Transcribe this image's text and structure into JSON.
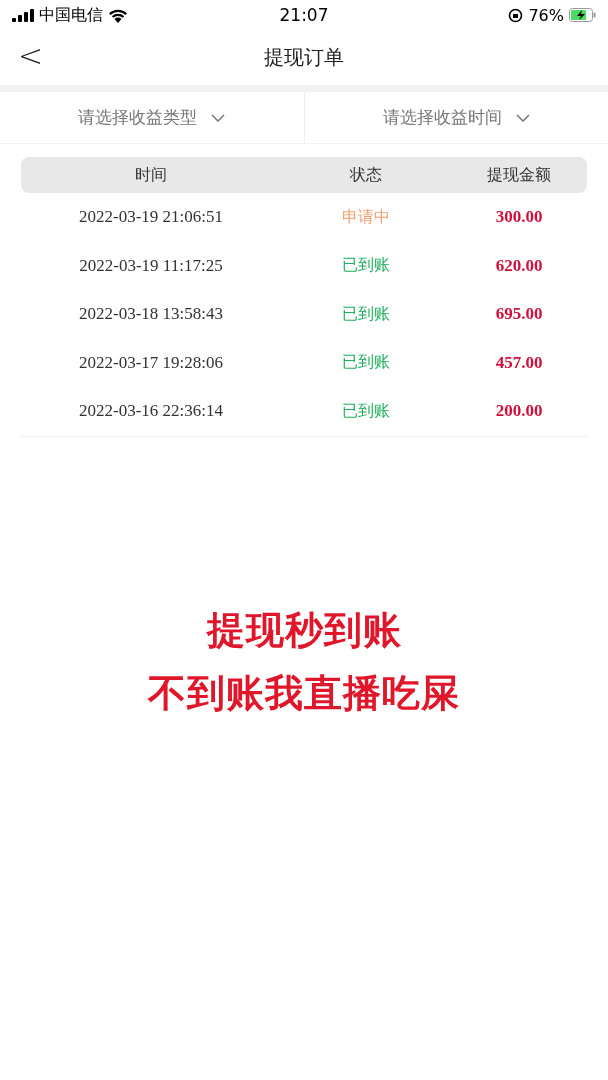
{
  "status_bar": {
    "carrier": "中国电信",
    "time": "21:07",
    "battery": "76%"
  },
  "nav": {
    "back": "<",
    "title": "提现订单"
  },
  "filters": [
    {
      "label": "请选择收益类型"
    },
    {
      "label": "请选择收益时间"
    }
  ],
  "table": {
    "columns": [
      "时间",
      "状态",
      "提现金额"
    ],
    "rows": [
      {
        "time": "2022-03-19 21:06:51",
        "status": "申请中",
        "kind": "pending",
        "amount": "300.00"
      },
      {
        "time": "2022-03-19 11:17:25",
        "status": "已到账",
        "kind": "done",
        "amount": "620.00"
      },
      {
        "time": "2022-03-18 13:58:43",
        "status": "已到账",
        "kind": "done",
        "amount": "695.00"
      },
      {
        "time": "2022-03-17 19:28:06",
        "status": "已到账",
        "kind": "done",
        "amount": "457.00"
      },
      {
        "time": "2022-03-16 22:36:14",
        "status": "已到账",
        "kind": "done",
        "amount": "200.00"
      }
    ]
  },
  "overlay": [
    "提现秒到账",
    "不到账我直播吃屎"
  ]
}
